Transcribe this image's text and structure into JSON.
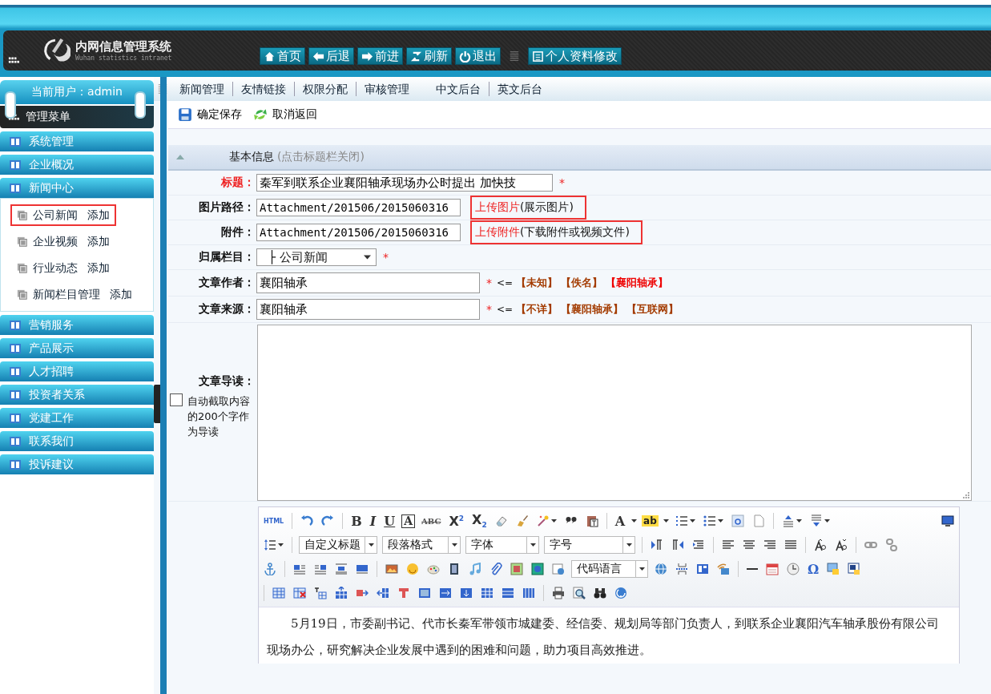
{
  "header": {
    "title": "内网信息管理系统",
    "subtitle": "Wuhan statistics intranet",
    "buttons": [
      {
        "label": "首页"
      },
      {
        "label": "后退"
      },
      {
        "label": "前进"
      },
      {
        "label": "刷新"
      },
      {
        "label": "退出"
      },
      {
        "label": "个人资料修改"
      }
    ]
  },
  "user": {
    "label": "当前用户：admin"
  },
  "top_nav": [
    {
      "label": "新闻管理",
      "divider": true
    },
    {
      "label": "友情链接",
      "divider": true
    },
    {
      "label": "权限分配",
      "divider": true
    },
    {
      "label": "审核管理",
      "divider": false
    },
    {
      "label": "中文后台",
      "divider": true
    },
    {
      "label": "英文后台",
      "divider": false
    }
  ],
  "sidebar": {
    "title": "管理菜单",
    "groups": [
      {
        "label": "系统管理"
      },
      {
        "label": "企业概况"
      },
      {
        "label": "新闻中心",
        "children": [
          {
            "label": "公司新闻",
            "action": "添加",
            "highlighted": true
          },
          {
            "label": "企业视频",
            "action": "添加",
            "highlighted": false
          },
          {
            "label": "行业动态",
            "action": "添加",
            "highlighted": false
          },
          {
            "label": "新闻栏目管理",
            "action": "添加",
            "highlighted": false
          }
        ]
      },
      {
        "label": "营销服务"
      },
      {
        "label": "产品展示"
      },
      {
        "label": "人才招聘"
      },
      {
        "label": "投资者关系"
      },
      {
        "label": "党建工作"
      },
      {
        "label": "联系我们"
      },
      {
        "label": "投诉建议"
      }
    ]
  },
  "actions": [
    {
      "label": "确定保存"
    },
    {
      "label": "取消返回"
    }
  ],
  "section": {
    "title": "基本信息",
    "hint": "(点击标题栏关闭)",
    "expanded": true
  },
  "form": [
    {
      "kind": "text",
      "label": "标题：",
      "emphasis": true,
      "value": "秦军到联系企业襄阳轴承现场办公时提出 加快技",
      "mark": "*"
    },
    {
      "kind": "path",
      "label": "图片路径：",
      "emphasis": false,
      "value": "Attachment/201506/2015060316",
      "link": "上传图片",
      "note": "(展示图片)",
      "highlighted": true
    },
    {
      "kind": "path",
      "label": "附件：",
      "emphasis": false,
      "value": "Attachment/201506/2015060316",
      "link": "上传附件",
      "note": "(下载附件或视频文件)",
      "highlighted": true
    },
    {
      "kind": "select",
      "label": "归属栏目：",
      "emphasis": false,
      "value": "├ 公司新闻",
      "mark": "*"
    },
    {
      "kind": "choice",
      "label": "文章作者：",
      "emphasis": false,
      "value": "襄阳轴承",
      "mark": "*",
      "hint": "<=",
      "options": [
        {
          "label": "【未知】",
          "selected": false
        },
        {
          "label": "【佚名】",
          "selected": false
        },
        {
          "label": "【襄阳轴承】",
          "selected": true
        }
      ]
    },
    {
      "kind": "choice",
      "label": "文章来源：",
      "emphasis": false,
      "value": "襄阳轴承",
      "mark": "*",
      "hint": "<=",
      "options": [
        {
          "label": "【不详】",
          "selected": false
        },
        {
          "label": "【襄阳轴承】",
          "selected": false
        },
        {
          "label": "【互联网】",
          "selected": false
        }
      ]
    },
    {
      "kind": "area",
      "label": "文章导读：",
      "checkbox": {
        "label": "自动截取内容的200个字作为导读",
        "checked": false
      }
    }
  ],
  "editor": {
    "glyphs": [
      "HTML",
      "B",
      "I",
      "U",
      "A",
      "ABC",
      "X$^{2}$",
      "X$_{2}$",
      "A",
      "ab",
      "Ω"
    ],
    "selects": [
      "自定义标题",
      "段落格式",
      "字体",
      "字号",
      "代码语言"
    ],
    "content": [
      "5月19日，市委副书记、代市长秦军带领市城建委、经信委、规划局等部门负责人，到联系企业襄阳汽车轴承股份有限公司现场办公，研究解决企业发展中遇到的困难和问题，助力项目高效推进。"
    ]
  }
}
